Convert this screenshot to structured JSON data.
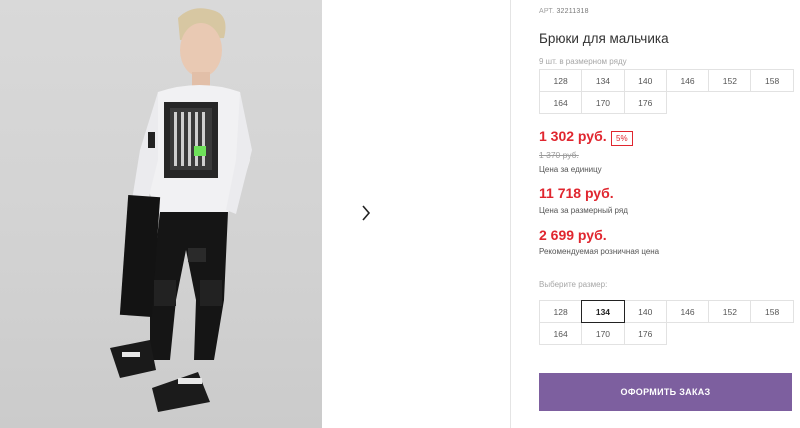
{
  "product": {
    "article_label": "АРТ.",
    "article_value": "32211318",
    "title": "Брюки для мальчика"
  },
  "size_row": {
    "hint": "9 шт. в размерном ряду",
    "sizes": [
      "128",
      "134",
      "140",
      "146",
      "152",
      "158",
      "164",
      "170",
      "176"
    ]
  },
  "pricing": {
    "unit_price": "1 302 руб.",
    "discount_badge": "5%",
    "old_price": "1 370 руб.",
    "unit_price_note": "Цена за единицу",
    "row_price": "11 718 руб.",
    "row_price_note": "Цена за размерный ряд",
    "retail_price": "2 699 руб.",
    "retail_price_note": "Рекомендуемая розничная цена"
  },
  "size_picker": {
    "label": "Выберите размер:",
    "sizes": [
      "128",
      "134",
      "140",
      "146",
      "152",
      "158",
      "164",
      "170",
      "176"
    ],
    "selected": "134"
  },
  "actions": {
    "order_button": "ОФОРМИТЬ ЗАКАЗ"
  },
  "colors": {
    "price_red": "#e0262f",
    "order_button_bg": "#7d5f9f",
    "photo_bg": "#d5d5d5"
  },
  "icons": {
    "next": "chevron-right-icon"
  }
}
